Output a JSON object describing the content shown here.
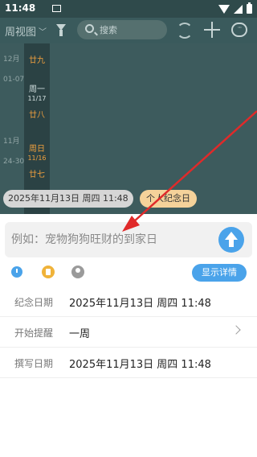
{
  "status_bar": {
    "time": "11:48"
  },
  "toolbar": {
    "view_label": "周视图",
    "search_placeholder": "搜索"
  },
  "calendar": {
    "time_labels": [
      "12月",
      "01-07",
      "11月",
      "24-30"
    ],
    "lunar_top": "廿九",
    "weekday_1": "周一",
    "date_1": "11/17",
    "lunar_1": "廿八",
    "weekday_2": "周日",
    "date_2": "11/16",
    "lunar_2": "廿七"
  },
  "chips": {
    "datetime": "2025年11月13日 周四 11:48",
    "type": "个人纪念日"
  },
  "sheet": {
    "title_placeholder": "例如：宠物狗狗旺财的到家日",
    "details_label": "显示详情",
    "fields": [
      {
        "label": "纪念日期",
        "value": "2025年11月13日 周四 11:48"
      },
      {
        "label": "开始提醒",
        "value": "一周"
      },
      {
        "label": "撰写日期",
        "value": "2025年11月13日 周四 11:48"
      }
    ]
  },
  "colors": {
    "accent": "#4aa3ea",
    "header": "#3a5a5c",
    "annotation_arrow": "#e02a2a"
  }
}
